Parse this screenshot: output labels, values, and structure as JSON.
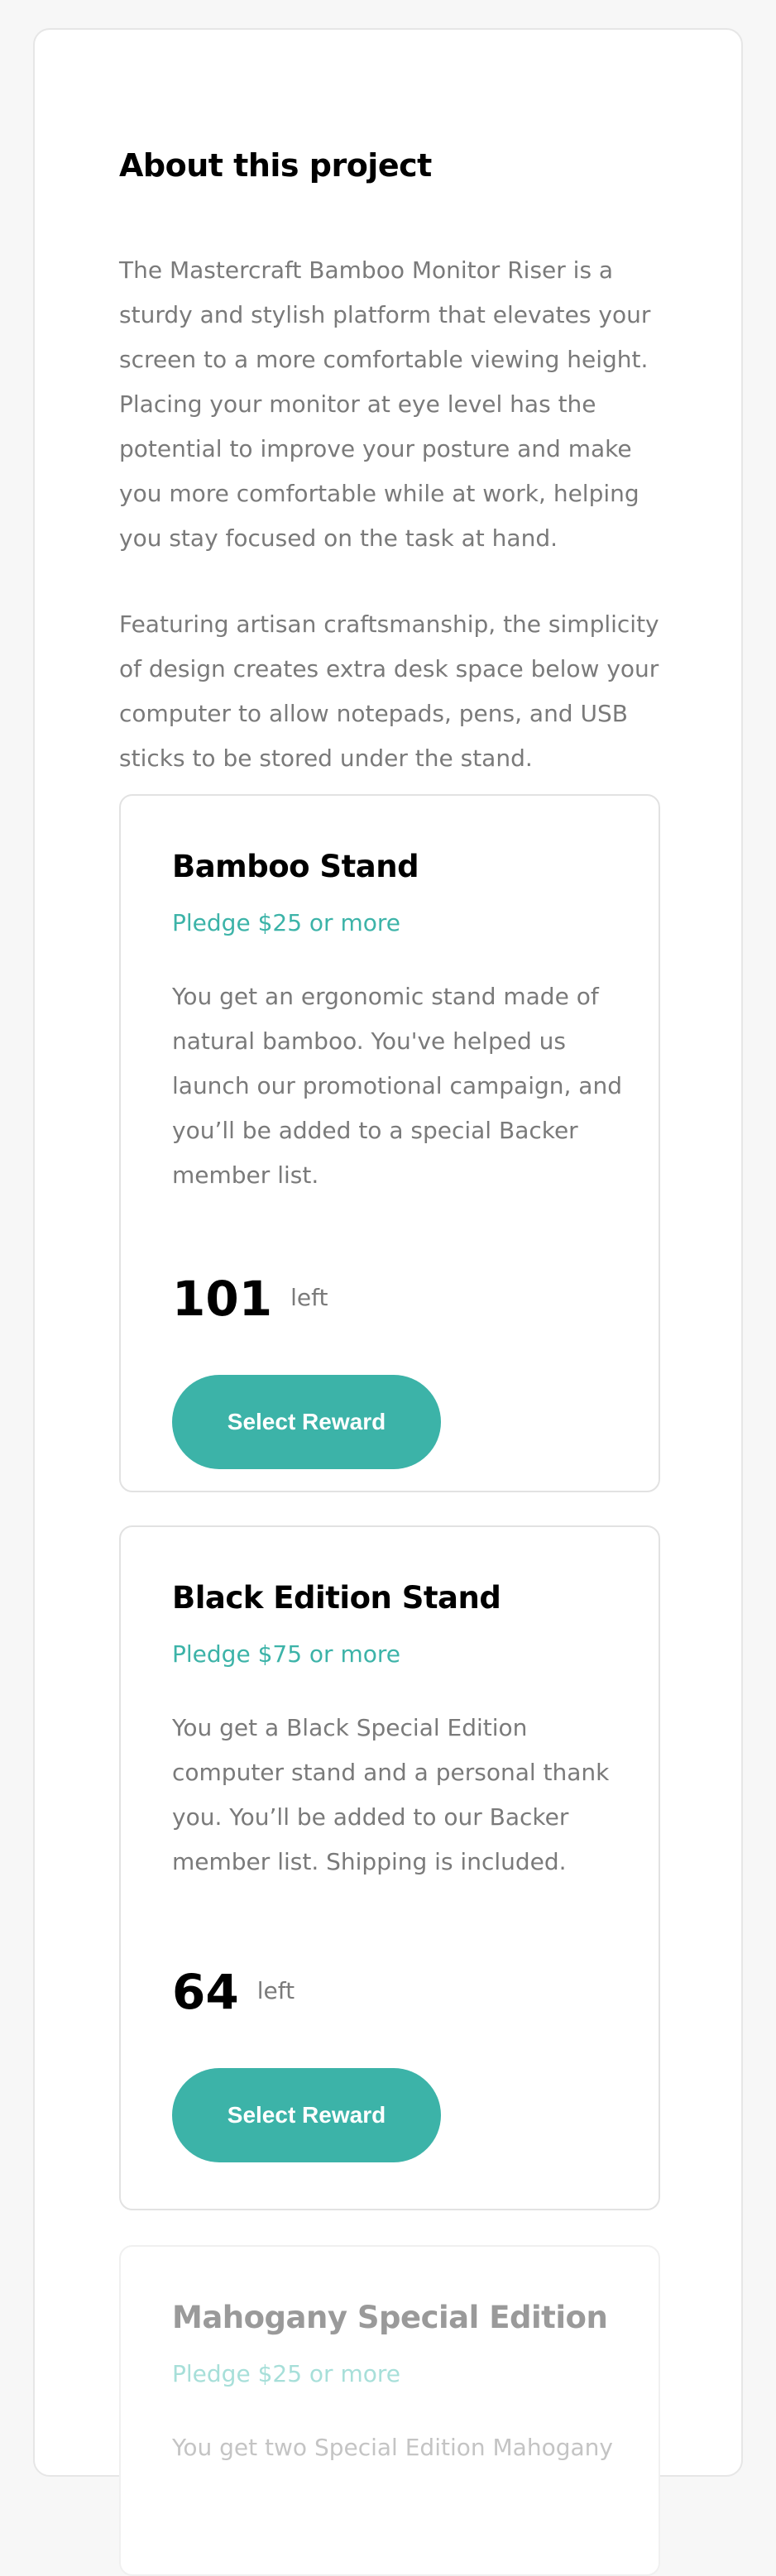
{
  "about": {
    "title": "About this project",
    "paragraphs": [
      "The Mastercraft Bamboo Monitor Riser is a sturdy and stylish platform that elevates your screen to a more comfortable viewing height. Placing your monitor at eye level has the potential to improve your posture and make you more comfortable while at work, helping you stay focused on the task at hand.",
      "Featuring artisan craftsmanship, the simplicity of design creates extra desk space below your computer to allow notepads, pens, and USB sticks to be stored under the stand."
    ]
  },
  "rewards": [
    {
      "name": "Bamboo Stand",
      "pledge": "Pledge $25 or more",
      "description": "You get an ergonomic stand made of natural bamboo. You've helped us launch our promotional campaign, and you’ll be added to a special Backer member list.",
      "count": "101",
      "left_label": "left",
      "button_label": "Select Reward"
    },
    {
      "name": "Black Edition Stand",
      "pledge": "Pledge $75 or more",
      "description": "You get a Black Special Edition computer stand and a personal thank you. You’ll be added to our Backer member list. Shipping is included.",
      "count": "64",
      "left_label": "left",
      "button_label": "Select Reward"
    },
    {
      "name": "Mahogany Special Edition",
      "pledge": "Pledge $25 or more",
      "description": "You get two Special Edition Mahogany"
    }
  ],
  "colors": {
    "accent": "#3cb3a8",
    "text_muted": "#7a7a7a",
    "background": "#f7f7f7"
  }
}
